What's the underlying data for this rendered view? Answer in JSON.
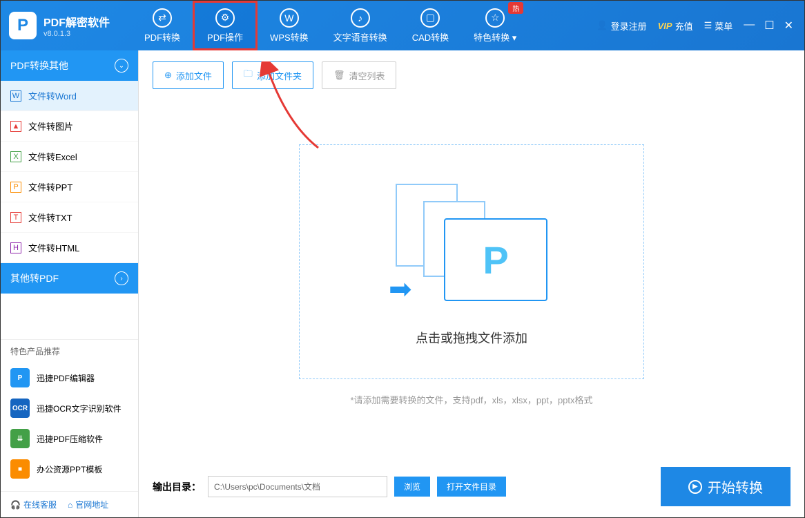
{
  "app": {
    "name": "PDF解密软件",
    "version": "v8.0.1.3"
  },
  "nav": {
    "tabs": [
      {
        "label": "PDF转换"
      },
      {
        "label": "PDF操作"
      },
      {
        "label": "WPS转换"
      },
      {
        "label": "文字语音转换"
      },
      {
        "label": "CAD转换"
      },
      {
        "label": "特色转换"
      }
    ],
    "hot_badge": "热"
  },
  "header_right": {
    "login": "登录注册",
    "vip": "VIP",
    "vip_charge": "充值",
    "menu": "菜单"
  },
  "sidebar": {
    "section1_title": "PDF转换其他",
    "items": [
      {
        "label": "文件转Word"
      },
      {
        "label": "文件转图片"
      },
      {
        "label": "文件转Excel"
      },
      {
        "label": "文件转PPT"
      },
      {
        "label": "文件转TXT"
      },
      {
        "label": "文件转HTML"
      }
    ],
    "section2_title": "其他转PDF",
    "promo_title": "特色产品推荐",
    "promo": [
      {
        "label": "迅捷PDF编辑器"
      },
      {
        "label": "迅捷OCR文字识别软件"
      },
      {
        "label": "迅捷PDF压缩软件"
      },
      {
        "label": "办公资源PPT模板"
      }
    ],
    "footer": {
      "service": "在线客服",
      "site": "官网地址"
    }
  },
  "toolbar": {
    "add_file": "添加文件",
    "add_folder": "添加文件夹",
    "clear_list": "清空列表"
  },
  "dropzone": {
    "text": "点击或拖拽文件添加",
    "hint": "*请添加需要转换的文件，支持pdf，xls，xlsx，ppt，pptx格式"
  },
  "bottom": {
    "output_label": "输出目录：",
    "output_path": "C:\\Users\\pc\\Documents\\文档",
    "browse": "浏览",
    "open_dir": "打开文件目录",
    "convert": "开始转换"
  }
}
